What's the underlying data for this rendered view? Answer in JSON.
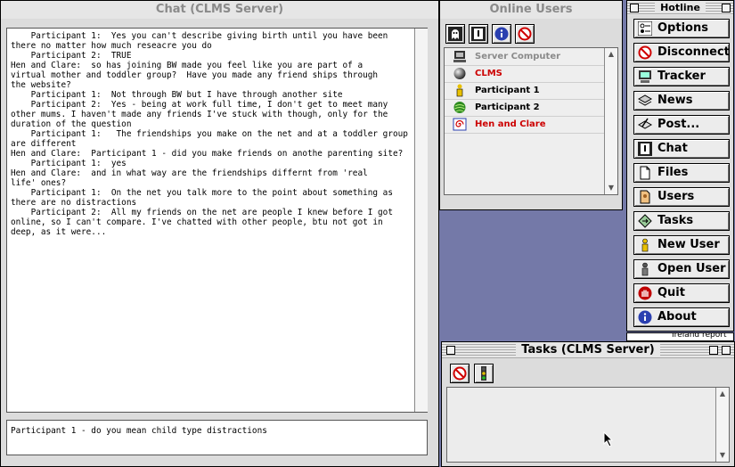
{
  "chat_window": {
    "title": "Chat (CLMS Server)",
    "transcript": "    Participant 1:  Yes you can't describe giving birth until you have been\nthere no matter how much reseacre you do\n    Participant 2:  TRUE\nHen and Clare:  so has joining BW made you feel like you are part of a\nvirtual mother and toddler group?  Have you made any friend ships through\nthe website?\n    Participant 1:  Not through BW but I have through another site\n    Participant 2:  Yes - being at work full time, I don't get to meet many\nother mums. I haven't made any friends I've stuck with though, only for the\nduration of the question\n    Participant 1:   The friendships you make on the net and at a toddler group\nare different\nHen and Clare:  Participant 1 - did you make friends on anothe parenting site?\n    Participant 1:  yes\nHen and Clare:  and in what way are the friendships differnt from 'real\nlife' ones?\n    Participant 1:  On the net you talk more to the point about something as\nthere are no distractions\n    Participant 2:  All my friends on the net are people I knew before I got\nonline, so I can't compare. I've chatted with other people, btu not got in\ndeep, as it were...",
    "input_value": "Participant 1 - do you mean child type distractions"
  },
  "online_users": {
    "title": "Online Users",
    "toolbar_icons": [
      "ghost-icon",
      "private-chat-icon",
      "info-icon",
      "no-entry-icon"
    ],
    "users": [
      {
        "name": "Server Computer",
        "color": "#8a8a8a",
        "icon": "computer-icon"
      },
      {
        "name": "CLMS",
        "color": "#cc0000",
        "icon": "sphere-icon"
      },
      {
        "name": "Participant 1",
        "color": "#000000",
        "icon": "person-icon"
      },
      {
        "name": "Participant 2",
        "color": "#000000",
        "icon": "green-ball-icon"
      },
      {
        "name": "Hen and Clare",
        "color": "#cc0000",
        "icon": "spiral-icon"
      }
    ]
  },
  "hotline": {
    "title": "Hotline",
    "buttons": [
      {
        "label": "Options",
        "icon": "options-icon"
      },
      {
        "label": "Disconnect",
        "icon": "disconnect-icon"
      },
      {
        "label": "Tracker",
        "icon": "tracker-icon"
      },
      {
        "label": "News",
        "icon": "news-icon"
      },
      {
        "label": "Post...",
        "icon": "post-icon"
      },
      {
        "label": "Chat",
        "icon": "chat-icon"
      },
      {
        "label": "Files",
        "icon": "files-icon"
      },
      {
        "label": "Users",
        "icon": "users-icon"
      },
      {
        "label": "Tasks",
        "icon": "tasks-icon"
      },
      {
        "label": "New User",
        "icon": "new-user-icon"
      },
      {
        "label": "Open User",
        "icon": "open-user-icon"
      },
      {
        "label": "Quit",
        "icon": "quit-icon"
      },
      {
        "label": "About",
        "icon": "about-icon"
      }
    ]
  },
  "background_window_text": "Ireland report",
  "tasks_window": {
    "title": "Tasks (CLMS Server)",
    "toolbar_icons": [
      "stop-icon",
      "traffic-light-icon"
    ]
  },
  "colors": {
    "desktop": "#7479a8",
    "red_user": "#cc0000",
    "grey_user": "#8a8a8a"
  }
}
